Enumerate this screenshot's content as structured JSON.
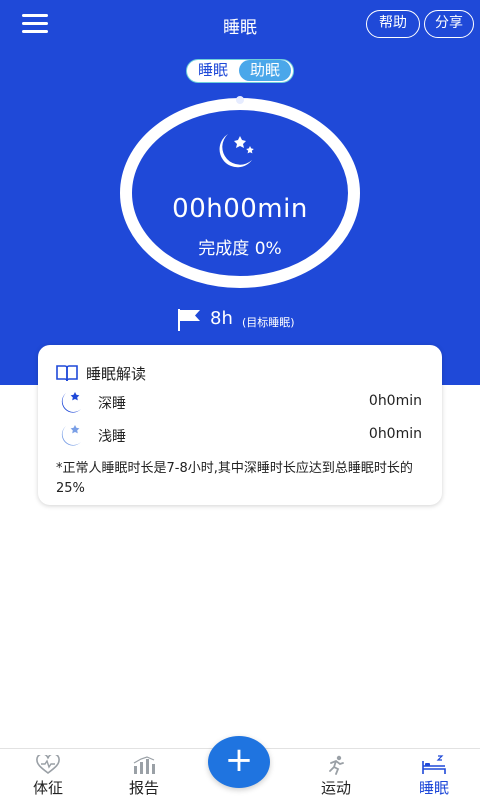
{
  "header": {
    "title": "睡眠",
    "help_label": "帮助",
    "share_label": "分享"
  },
  "mode_toggle": {
    "options": [
      "睡眠",
      "助眠"
    ],
    "selected": "助眠"
  },
  "summary": {
    "duration": "00h00min",
    "completion_label": "完成度",
    "completion_value": "0%",
    "completion_fraction": 0
  },
  "goal": {
    "hours": "8h",
    "label": "(目标睡眠)"
  },
  "interpretation": {
    "title": "睡眠解读",
    "rows": [
      {
        "label": "深睡",
        "value": "0h0min",
        "icon": "moon-star-dark-icon"
      },
      {
        "label": "浅睡",
        "value": "0h0min",
        "icon": "moon-star-light-icon"
      }
    ],
    "note": "*正常人睡眠时长是7-8小时,其中深睡时长应达到总睡眠时长的25%"
  },
  "tabbar": {
    "tabs": [
      {
        "label": "体征",
        "icon": "heart-pulse-icon",
        "active": false
      },
      {
        "label": "报告",
        "icon": "bar-chart-icon",
        "active": false
      },
      {
        "label": "运动",
        "icon": "runner-icon",
        "active": false
      },
      {
        "label": "睡眠",
        "icon": "bed-icon",
        "active": true
      }
    ],
    "fab_symbol": "+"
  },
  "colors": {
    "primary": "#1f49d8",
    "accent": "#4aa7ea",
    "fab": "#1f74e0",
    "deep_sleep": "#1f49d8",
    "light_sleep": "#7a9fe6"
  }
}
